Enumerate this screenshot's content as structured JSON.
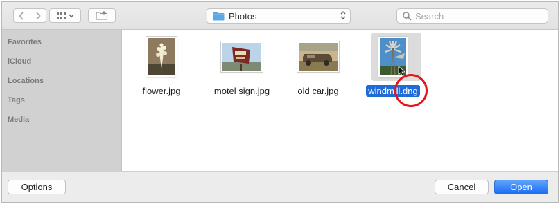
{
  "toolbar": {
    "path_folder": "Photos",
    "search_placeholder": "Search"
  },
  "sidebar": {
    "items": [
      {
        "label": "Favorites"
      },
      {
        "label": "iCloud"
      },
      {
        "label": "Locations"
      },
      {
        "label": "Tags"
      },
      {
        "label": "Media"
      }
    ]
  },
  "files": [
    {
      "name": "flower.jpg",
      "selected": false
    },
    {
      "name": "motel sign.jpg",
      "selected": false
    },
    {
      "name": "old car.jpg",
      "selected": false
    },
    {
      "name": "windmill.dng",
      "selected": true
    }
  ],
  "footer": {
    "options_label": "Options",
    "cancel_label": "Cancel",
    "open_label": "Open"
  },
  "colors": {
    "accent": "#1f6bd8",
    "highlight_circle": "#e4141b"
  }
}
